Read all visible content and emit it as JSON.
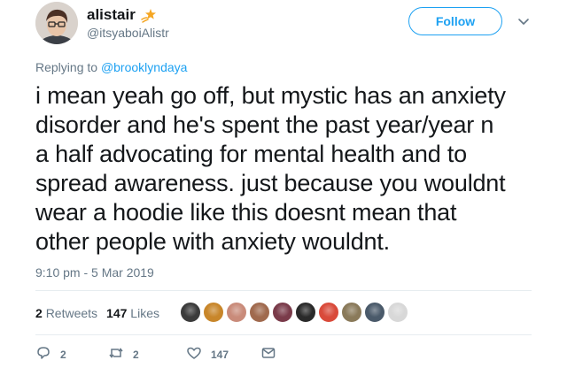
{
  "author": {
    "display_name": "alistair",
    "handle": "@itsyaboiAlistr",
    "badge_icon": "shooting-star-icon"
  },
  "follow_label": "Follow",
  "reply": {
    "prefix": "Replying to",
    "mention": "@brooklyndaya"
  },
  "tweet": {
    "text": "i mean yeah go off, but mystic has an anxiety\ndisorder and he's spent the past year/year n\na half advocating for mental health and to\nspread awareness. just because you wouldnt\nwear a hoodie like this doesnt mean that\nother people with anxiety wouldnt.",
    "timestamp": "9:10 pm - 5 Mar 2019"
  },
  "stats": {
    "retweets_count": "2",
    "retweets_label": "Retweets",
    "likes_count": "147",
    "likes_label": "Likes"
  },
  "likers": [
    {
      "color": "#3b3b3b"
    },
    {
      "color": "#c8862a"
    },
    {
      "color": "#c98b7a"
    },
    {
      "color": "#a06a4e"
    },
    {
      "color": "#7a3b4a"
    },
    {
      "color": "#2a2a2a"
    },
    {
      "color": "#d94a3a"
    },
    {
      "color": "#8a7a5a"
    },
    {
      "color": "#4a5a6a"
    },
    {
      "color": "#d8d8d8"
    }
  ],
  "actions": {
    "reply_count": "2",
    "retweet_count": "2",
    "like_count": "147"
  },
  "colors": {
    "accent": "#1da1f2",
    "muted": "#657786",
    "star": "#f5a623"
  }
}
